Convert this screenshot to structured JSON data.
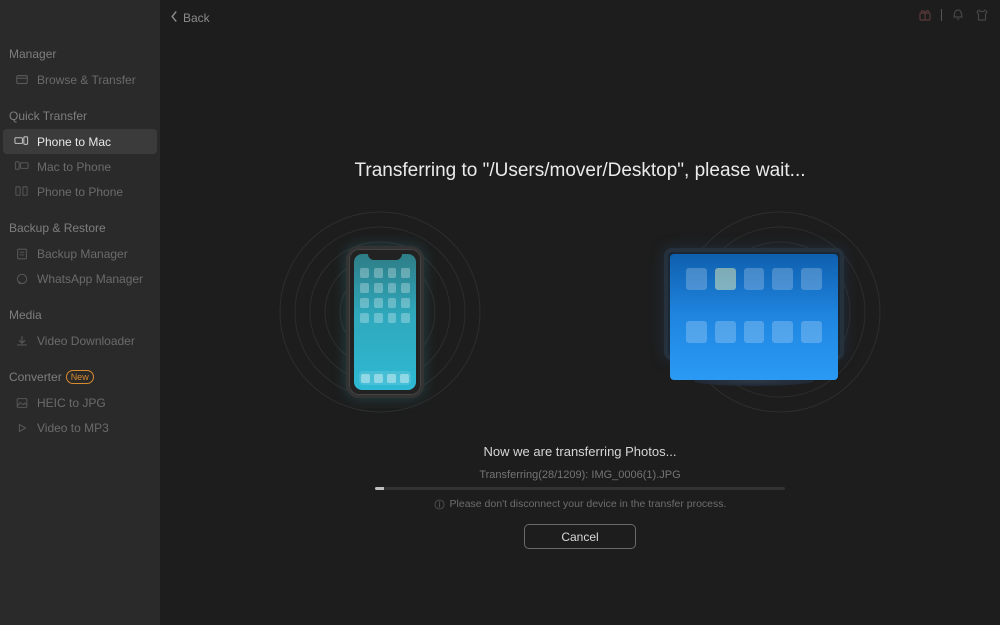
{
  "topbar": {
    "back_label": "Back"
  },
  "sidebar": {
    "sections": {
      "manager": {
        "label": "Manager",
        "items": {
          "browse": "Browse & Transfer"
        }
      },
      "quick_transfer": {
        "label": "Quick Transfer",
        "items": {
          "phone_to_mac": "Phone to Mac",
          "mac_to_phone": "Mac to Phone",
          "phone_to_phone": "Phone to Phone"
        }
      },
      "backup_restore": {
        "label": "Backup & Restore",
        "items": {
          "backup_manager": "Backup Manager",
          "whatsapp_manager": "WhatsApp Manager"
        }
      },
      "media": {
        "label": "Media",
        "items": {
          "video_downloader": "Video Downloader"
        }
      },
      "converter": {
        "label": "Converter",
        "badge": "New",
        "items": {
          "heic_to_jpg": "HEIC to JPG",
          "video_to_mp3": "Video to MP3"
        }
      }
    }
  },
  "transfer": {
    "title": "Transferring to \"/Users/mover/Desktop\", please wait...",
    "status_line1": "Now we are transferring Photos...",
    "status_line2": "Transferring(28/1209): IMG_0006(1).JPG",
    "warning": "Please don't disconnect your device in the transfer process.",
    "cancel_label": "Cancel",
    "progress_percent": 2.3
  }
}
